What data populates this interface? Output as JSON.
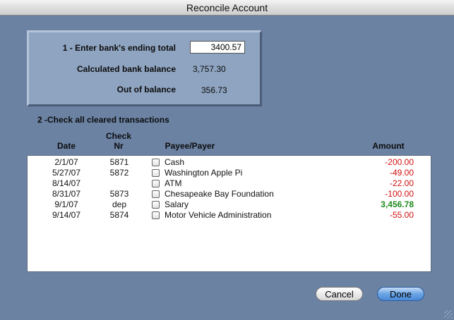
{
  "window": {
    "title": "Reconcile Account"
  },
  "step1": {
    "label": "1 - Enter bank's ending total",
    "input_value": "3400.57",
    "calc_label": "Calculated bank balance",
    "calc_value": "3,757.30",
    "oob_label": "Out of balance",
    "oob_value": "356.73"
  },
  "step2": {
    "label": "2 -Check all cleared transactions"
  },
  "columns": {
    "date": "Date",
    "check_line1": "Check",
    "check_line2": "Nr",
    "payee": "Payee/Payer",
    "amount": "Amount"
  },
  "transactions": [
    {
      "date": "2/1/07",
      "check": "5871",
      "payee": "Cash",
      "amount": "-200.00",
      "cleared": false
    },
    {
      "date": "5/27/07",
      "check": "5872",
      "payee": "Washington Apple Pi",
      "amount": "-49.00",
      "cleared": false
    },
    {
      "date": "8/14/07",
      "check": "",
      "payee": "ATM",
      "amount": "-22.00",
      "cleared": false
    },
    {
      "date": "8/31/07",
      "check": "5873",
      "payee": "Chesapeake Bay Foundation",
      "amount": "-100.00",
      "cleared": false
    },
    {
      "date": "9/1/07",
      "check": "dep",
      "payee": "Salary",
      "amount": "3,456.78",
      "cleared": false
    },
    {
      "date": "9/14/07",
      "check": "5874",
      "payee": "Motor Vehicle Administration",
      "amount": "-55.00",
      "cleared": false
    }
  ],
  "buttons": {
    "cancel": "Cancel",
    "done": "Done"
  },
  "colors": {
    "background": "#6b82a3",
    "panel": "#8ea4c0",
    "negative": "#d01010",
    "positive": "#1e8a1e",
    "default_button": "#4a8ad8"
  }
}
